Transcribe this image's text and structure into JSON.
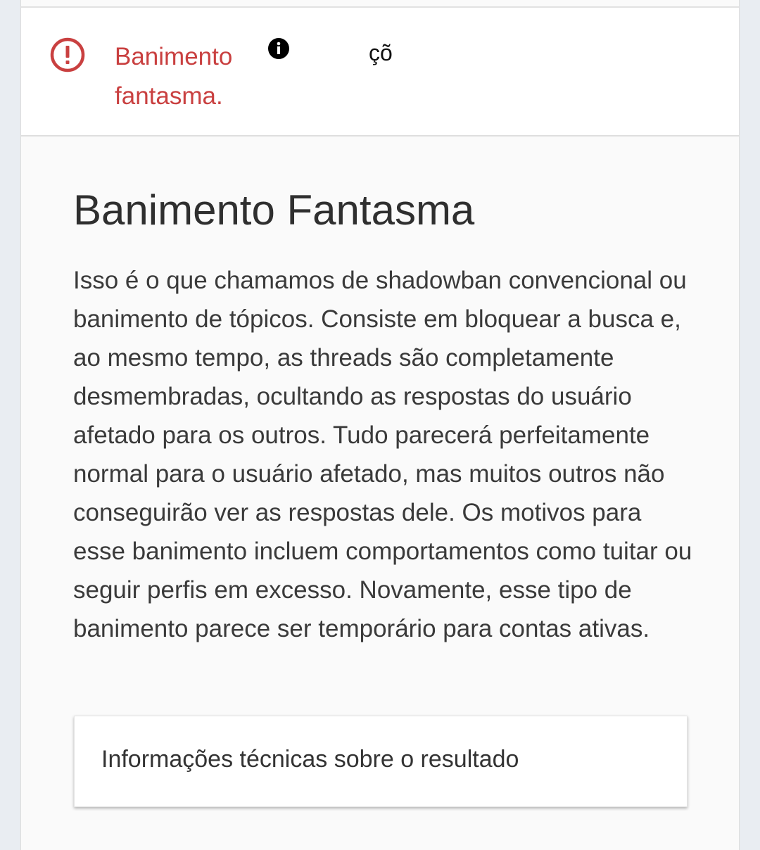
{
  "result": {
    "label": "Banimento fantasma.",
    "value": "çõ",
    "status_color": "#c94040",
    "status_icon": "alert-circle-icon",
    "info_icon": "info-icon"
  },
  "section": {
    "title": "Banimento Fantasma",
    "description": "Isso é o que chamamos de shadowban convencional ou banimento de tópicos. Consiste em bloquear a busca e, ao mesmo tempo, as threads são completamente desmembradas, ocultando as respostas do usuário afetado para os outros. Tudo parecerá perfeitamente normal para o usuário afetado, mas muitos outros não conseguirão ver as respostas dele. Os motivos para esse banimento incluem comportamentos como tuitar ou seguir perfis em excesso. Novamente, esse tipo de banimento parece ser temporário para contas ativas."
  },
  "technical": {
    "label": "Informações técnicas sobre o resultado"
  }
}
